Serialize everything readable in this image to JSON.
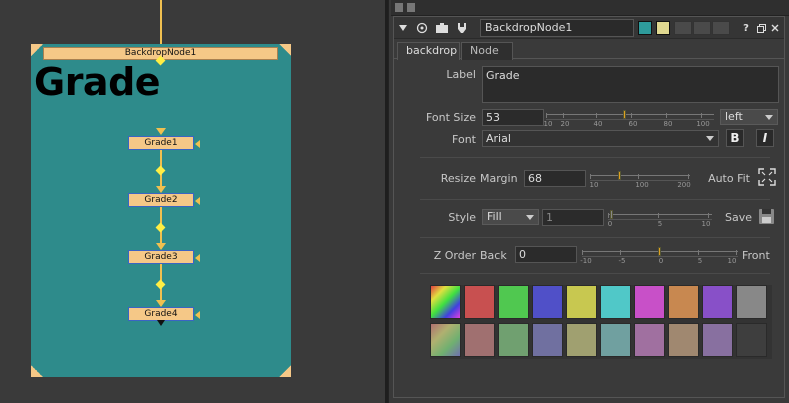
{
  "graph": {
    "backdrop_title": "BackdropNode1",
    "backdrop_label": "Grade",
    "nodes": [
      "Grade1",
      "Grade2",
      "Grade3",
      "Grade4"
    ],
    "backdrop_color": "#2e8b8b",
    "node_color": "#f5c887"
  },
  "panel": {
    "node_name": "BackdropNode1",
    "title_buttons": [
      "?",
      "close"
    ],
    "tabs": [
      {
        "label": "backdrop",
        "active": true
      },
      {
        "label": "Node",
        "active": false
      }
    ],
    "label_field": {
      "label": "Label",
      "value": "Grade"
    },
    "font_size": {
      "label": "Font Size",
      "value": "53",
      "slider_ticks": [
        "10",
        "20",
        "40",
        "60",
        "80",
        "100"
      ],
      "align_value": "left"
    },
    "font": {
      "label": "Font",
      "value": "Arial",
      "bold_label": "B",
      "italic_label": "I"
    },
    "resize": {
      "label": "Resize",
      "margin_label": "Margin",
      "margin_value": "68",
      "slider_ticks": [
        "10",
        "100",
        "200"
      ],
      "autofit_label": "Auto Fit"
    },
    "style": {
      "label": "Style",
      "style_value": "Fill",
      "opacity_value": "1",
      "slider_ticks": [
        "0",
        "5",
        "10"
      ],
      "save_label": "Save"
    },
    "zorder": {
      "label": "Z Order",
      "back_label": "Back",
      "value": "0",
      "slider_ticks": [
        "-10",
        "-5",
        "0",
        "5",
        "10"
      ],
      "front_label": "Front"
    },
    "swatches_row1": [
      "#b84a4a-rainbow",
      "#c85050",
      "#50c850",
      "#5050c8",
      "#c8c850",
      "#50c8c8",
      "#c850c8",
      "#c88850",
      "#8850c8",
      "#888888"
    ],
    "swatches_row2": [
      "#9a7a6a",
      "#a07070",
      "#70a070",
      "#7070a0",
      "#a0a070",
      "#70a0a0",
      "#a070a0",
      "#a08870",
      "#8870a0",
      "#444444"
    ]
  }
}
